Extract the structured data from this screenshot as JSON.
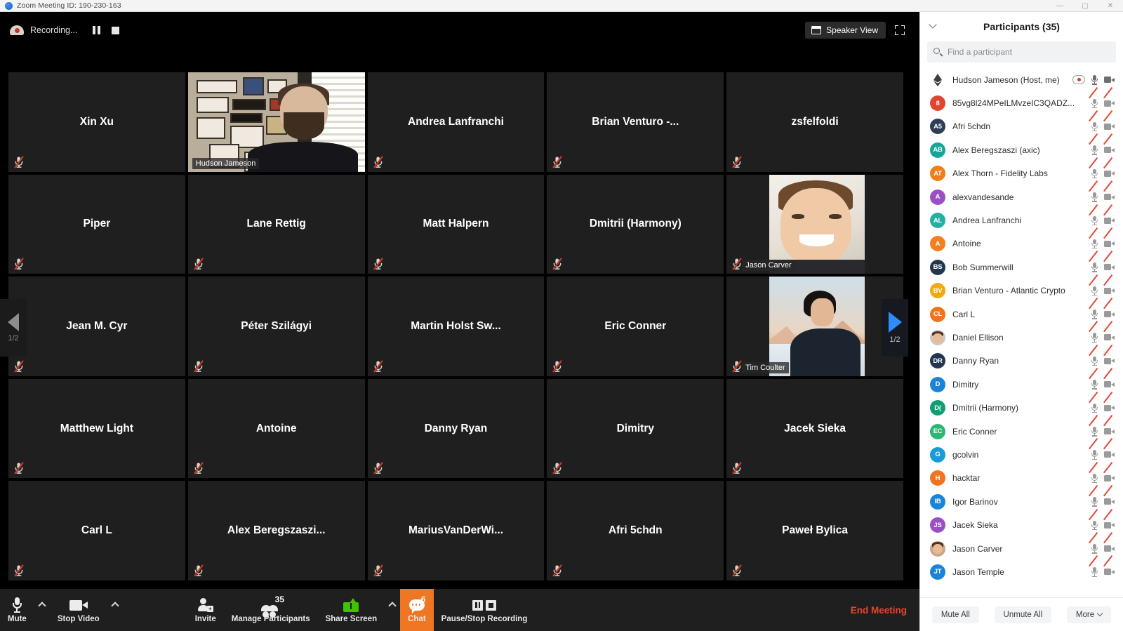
{
  "window": {
    "title": "Zoom Meeting ID: 190-230-163",
    "minimize": "—",
    "maximize": "▢",
    "close": "✕"
  },
  "meeting": {
    "recording_label": "Recording...",
    "speaker_view_label": "Speaker View",
    "page_prev_count": "1/2",
    "page_next_count": "1/2",
    "tiles": [
      {
        "name": "Xin Xu",
        "video": false,
        "muted": true,
        "active": false
      },
      {
        "name": "Hudson Jameson",
        "video": true,
        "muted": false,
        "active": true,
        "style": "hudson"
      },
      {
        "name": "Andrea Lanfranchi",
        "video": false,
        "muted": true,
        "active": false
      },
      {
        "name": "Brian Venturo -...",
        "video": false,
        "muted": true,
        "active": false
      },
      {
        "name": "zsfelfoldi",
        "video": false,
        "muted": true,
        "active": false
      },
      {
        "name": "Piper",
        "video": false,
        "muted": true,
        "active": false
      },
      {
        "name": "Lane Rettig",
        "video": false,
        "muted": true,
        "active": false
      },
      {
        "name": "Matt Halpern",
        "video": false,
        "muted": true,
        "active": false
      },
      {
        "name": "Dmitrii (Harmony)",
        "video": false,
        "muted": true,
        "active": false
      },
      {
        "name": "Jason Carver",
        "video": true,
        "muted": true,
        "active": false,
        "style": "jason"
      },
      {
        "name": "Jean M. Cyr",
        "video": false,
        "muted": true,
        "active": false
      },
      {
        "name": "Péter Szilágyi",
        "video": false,
        "muted": true,
        "active": false
      },
      {
        "name": "Martin Holst Sw...",
        "video": false,
        "muted": true,
        "active": false
      },
      {
        "name": "Eric Conner",
        "video": false,
        "muted": true,
        "active": false
      },
      {
        "name": "Tim Coulter",
        "video": true,
        "muted": true,
        "active": false,
        "style": "tim"
      },
      {
        "name": "Matthew Light",
        "video": false,
        "muted": true,
        "active": false
      },
      {
        "name": "Antoine",
        "video": false,
        "muted": true,
        "active": false
      },
      {
        "name": "Danny Ryan",
        "video": false,
        "muted": true,
        "active": false
      },
      {
        "name": "Dimitry",
        "video": false,
        "muted": true,
        "active": false
      },
      {
        "name": "Jacek Sieka",
        "video": false,
        "muted": true,
        "active": false
      },
      {
        "name": "Carl L",
        "video": false,
        "muted": true,
        "active": false
      },
      {
        "name": "Alex Beregszaszi...",
        "video": false,
        "muted": true,
        "active": false
      },
      {
        "name": "MariusVanDerWi...",
        "video": false,
        "muted": true,
        "active": false
      },
      {
        "name": "Afri 5chdn",
        "video": false,
        "muted": true,
        "active": false
      },
      {
        "name": "Paweł Bylica",
        "video": false,
        "muted": true,
        "active": false
      }
    ]
  },
  "toolbar": {
    "mute": "Mute",
    "stop_video": "Stop Video",
    "invite": "Invite",
    "manage_participants": "Manage Participants",
    "participants_count": "35",
    "share_screen": "Share Screen",
    "chat": "Chat",
    "chat_badge": "6",
    "pause_stop_recording": "Pause/Stop Recording",
    "end_meeting": "End Meeting"
  },
  "participants_panel": {
    "title": "Participants (35)",
    "search_placeholder": "Find a participant",
    "search_value": "",
    "footer": {
      "mute_all": "Mute All",
      "unmute_all": "Unmute All",
      "more": "More"
    },
    "rows": [
      {
        "name": "Hudson Jameson (Host, me)",
        "initials": "",
        "color": "transparent",
        "avatar": "eth",
        "mic": "on",
        "cam": "on",
        "host_recording": true
      },
      {
        "name": "85vg8l24MPeILMvzeIC3QADZ...",
        "initials": "8",
        "color": "#e0462f",
        "mic": "muted",
        "cam": "muted"
      },
      {
        "name": "Afri 5chdn",
        "initials": "A5",
        "color": "#2d3e55",
        "mic": "muted",
        "cam": "muted"
      },
      {
        "name": "Alex Beregszaszi (axic)",
        "initials": "AB",
        "color": "#17a598",
        "mic": "muted",
        "cam": "muted"
      },
      {
        "name": "Alex Thorn - Fidelity Labs",
        "initials": "AT",
        "color": "#ef7d1a",
        "mic": "muted",
        "cam": "muted"
      },
      {
        "name": "alexvandesande",
        "initials": "A",
        "color": "#9b4fc4",
        "mic": "muted",
        "cam": "muted"
      },
      {
        "name": "Andrea Lanfranchi",
        "initials": "AL",
        "color": "#24b0a0",
        "mic": "muted",
        "cam": "muted"
      },
      {
        "name": "Antoine",
        "initials": "A",
        "color": "#f08021",
        "mic": "muted",
        "cam": "muted"
      },
      {
        "name": "Bob Summerwill",
        "initials": "BS",
        "color": "#22374f",
        "mic": "muted",
        "cam": "muted"
      },
      {
        "name": "Brian Venturo - Atlantic Crypto",
        "initials": "BV",
        "color": "#f2a90f",
        "mic": "muted",
        "cam": "muted"
      },
      {
        "name": "Carl L",
        "initials": "CL",
        "color": "#ef7518",
        "mic": "muted",
        "cam": "muted"
      },
      {
        "name": "Daniel Ellison",
        "initials": "",
        "color": "#cfc7bd",
        "avatar": "photo",
        "mic": "muted",
        "cam": "muted"
      },
      {
        "name": "Danny Ryan",
        "initials": "DR",
        "color": "#22374f",
        "mic": "muted",
        "cam": "muted"
      },
      {
        "name": "Dimitry",
        "initials": "D",
        "color": "#1a85d6",
        "mic": "muted",
        "cam": "muted"
      },
      {
        "name": "Dmitrii (Harmony)",
        "initials": "D(",
        "color": "#0f9e74",
        "mic": "muted",
        "cam": "muted"
      },
      {
        "name": "Eric Conner",
        "initials": "EC",
        "color": "#2bb673",
        "mic": "muted",
        "cam": "muted"
      },
      {
        "name": "gcolvin",
        "initials": "G",
        "color": "#1a9ad6",
        "mic": "muted",
        "cam": "muted"
      },
      {
        "name": "hacktar",
        "initials": "H",
        "color": "#f07420",
        "mic": "muted",
        "cam": "muted"
      },
      {
        "name": "Igor Barinov",
        "initials": "IB",
        "color": "#1a85d6",
        "mic": "muted",
        "cam": "muted"
      },
      {
        "name": "Jacek Sieka",
        "initials": "JS",
        "color": "#9b4fc4",
        "mic": "muted",
        "cam": "muted"
      },
      {
        "name": "Jason Carver",
        "initials": "",
        "color": "#c8a887",
        "avatar": "photo",
        "mic": "muted",
        "cam": "muted"
      },
      {
        "name": "Jason Temple",
        "initials": "JT",
        "color": "#1a85d6",
        "mic": "muted",
        "cam": "muted"
      }
    ]
  }
}
